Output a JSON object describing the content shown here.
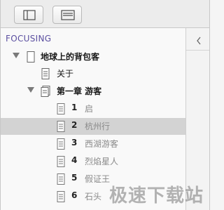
{
  "sidebar": {
    "section_title": "FOCUSING",
    "book": {
      "title": "地球上的背包客"
    },
    "about": {
      "title": "关于"
    },
    "chapter": {
      "title": "第一章 游客"
    },
    "items": [
      {
        "num": "1",
        "title": "启"
      },
      {
        "num": "2",
        "title": "杭州行"
      },
      {
        "num": "3",
        "title": "西湖游客"
      },
      {
        "num": "4",
        "title": "烈焰星人"
      },
      {
        "num": "5",
        "title": "假证王"
      },
      {
        "num": "6",
        "title": "石头"
      }
    ]
  },
  "watermark": "极速下载站",
  "icons": {
    "toolbar_left": "sidebar-toggle-icon",
    "toolbar_right": "list-view-icon",
    "collapse": "chevron-left-icon",
    "doc": "document-icon"
  },
  "colors": {
    "section_title": "#5b4fa0",
    "selected_row": "#d3d3d3"
  }
}
